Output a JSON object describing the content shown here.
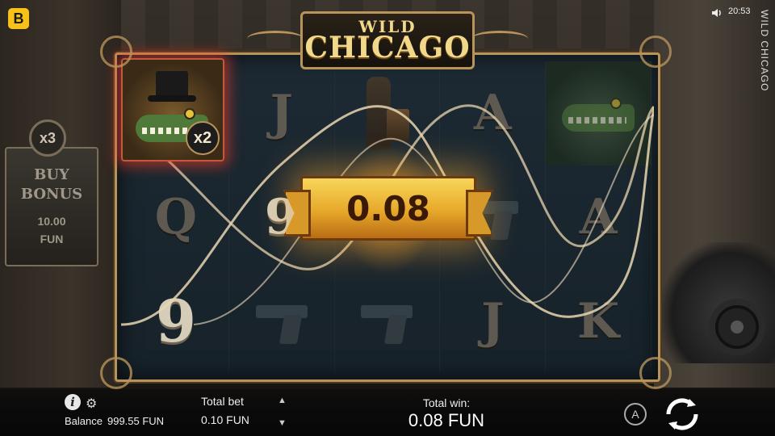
{
  "top": {
    "brand_letter": "B",
    "clock": "20:53",
    "side_title": "WILD CHICAGO"
  },
  "logo": {
    "line1": "WILD",
    "line2": "CHICAGO"
  },
  "buy_bonus": {
    "multiplier": "x3",
    "title_line1": "BUY",
    "title_line2": "BONUS",
    "price_line1": "10.00",
    "price_line2": "FUN"
  },
  "reels": {
    "wild_multiplier": "x2",
    "rows": [
      [
        "wild-gator",
        "J",
        "bottle",
        "A",
        "gator"
      ],
      [
        "Q",
        "9",
        "gun",
        "gun",
        "A"
      ],
      [
        "9",
        "gun",
        "gun",
        "J",
        "K"
      ]
    ]
  },
  "win_banner": "0.08",
  "bottom": {
    "balance_label": "Balance",
    "balance_value": "999.55 FUN",
    "total_bet_label": "Total bet",
    "total_bet_value": "0.10 FUN",
    "total_win_label": "Total win:",
    "total_win_value": "0.08 FUN",
    "auto_label": "A"
  },
  "colors": {
    "frame_gold": "#b8945a",
    "banner_gold": "#e7a82a",
    "wild_glow": "#ff3c28",
    "brand_yellow": "#f6c21a"
  }
}
